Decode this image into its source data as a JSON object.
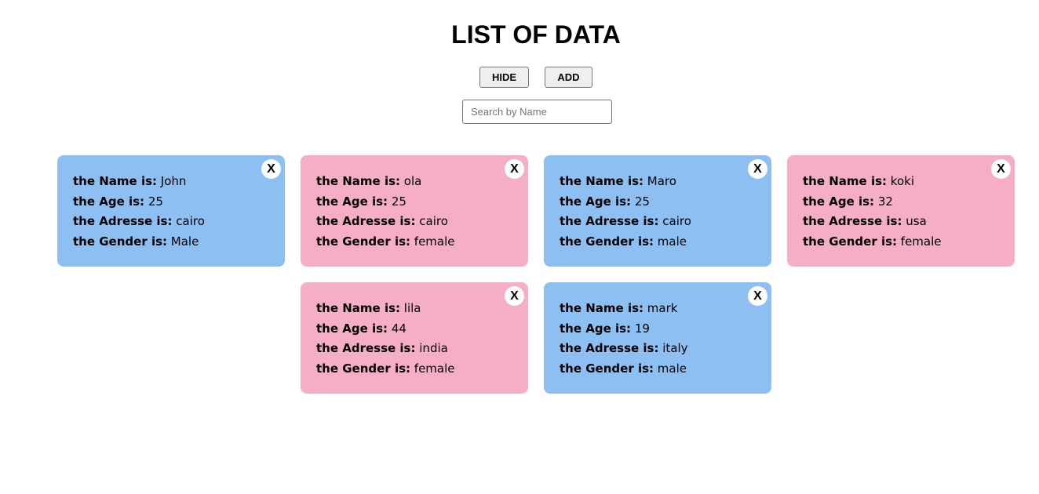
{
  "page": {
    "title": "LIST OF DATA"
  },
  "controls": {
    "hide_label": "HIDE",
    "add_label": "ADD",
    "search_placeholder": "Search by Name",
    "search_value": ""
  },
  "labels": {
    "name": "the Name is:",
    "age": "the Age is:",
    "address": "the Adresse is:",
    "gender": "the Gender is:"
  },
  "colors": {
    "male_card": "#8ebff3",
    "female_card": "#f5aec6",
    "close_button": "#ffffff"
  },
  "close_label": "X",
  "people": [
    {
      "name": "John",
      "age": "25",
      "address": "cairo",
      "gender": "Male"
    },
    {
      "name": "ola",
      "age": "25",
      "address": "cairo",
      "gender": "female"
    },
    {
      "name": "Maro",
      "age": "25",
      "address": "cairo",
      "gender": "male"
    },
    {
      "name": "koki",
      "age": "32",
      "address": "usa",
      "gender": "female"
    },
    {
      "name": "lila",
      "age": "44",
      "address": "india",
      "gender": "female"
    },
    {
      "name": "mark",
      "age": "19",
      "address": "italy",
      "gender": "male"
    }
  ]
}
